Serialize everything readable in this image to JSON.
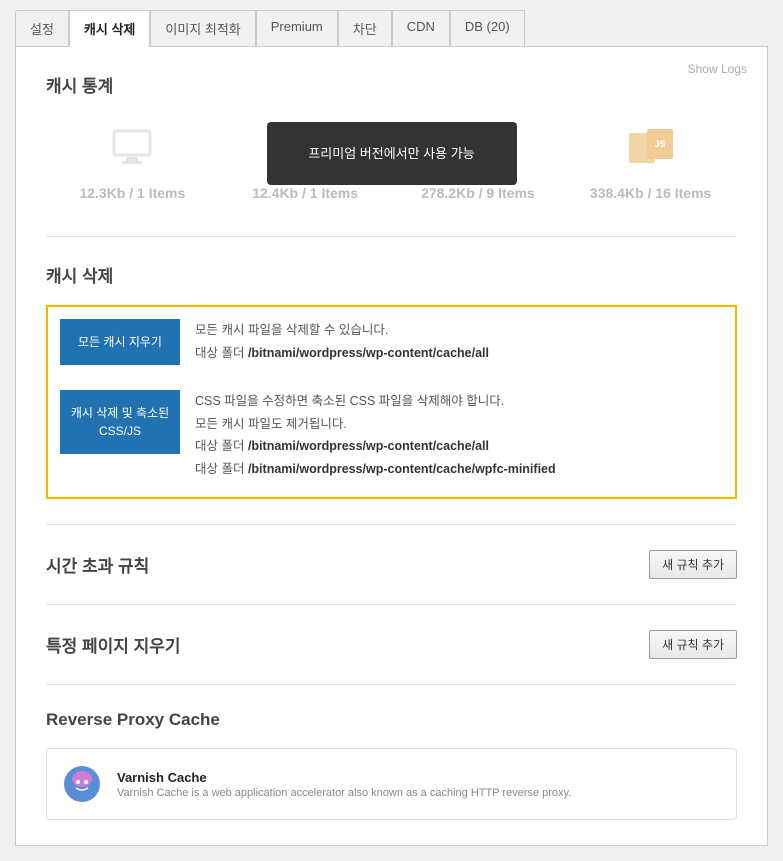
{
  "tabs": [
    {
      "label": "설정"
    },
    {
      "label": "캐시 삭제"
    },
    {
      "label": "이미지 최적화"
    },
    {
      "label": "Premium"
    },
    {
      "label": "차단"
    },
    {
      "label": "CDN"
    },
    {
      "label": "DB (20)"
    }
  ],
  "show_logs": "Show Logs",
  "stats": {
    "title": "캐시 통계",
    "tooltip": "프리미엄 버전에서만 사용 가능",
    "items": [
      {
        "label": "12.3Kb / 1 Items"
      },
      {
        "label": "12.4Kb / 1 Items"
      },
      {
        "label": "278.2Kb / 9 Items"
      },
      {
        "label": "338.4Kb / 16 Items"
      }
    ]
  },
  "delete": {
    "title": "캐시 삭제",
    "actions": [
      {
        "button": "모든 캐시 지우기",
        "lines": [
          {
            "text": "모든 캐시 파일을 삭제할 수 있습니다."
          },
          {
            "prefix": "대상 폴더 ",
            "path": "/bitnami/wordpress/wp-content/cache/all"
          }
        ]
      },
      {
        "button": "캐시 삭제 및 축소된 CSS/JS",
        "lines": [
          {
            "text": "CSS 파일을 수정하면 축소된 CSS 파일을 삭제해야 합니다."
          },
          {
            "text": "모든 캐시 파일도 제거됩니다."
          },
          {
            "prefix": "대상 폴더 ",
            "path": "/bitnami/wordpress/wp-content/cache/all"
          },
          {
            "prefix": "대상 폴더 ",
            "path": "/bitnami/wordpress/wp-content/cache/wpfc-minified"
          }
        ]
      }
    ]
  },
  "timeout": {
    "title": "시간 초과 규칙",
    "button": "새 규칙 추가"
  },
  "clear_page": {
    "title": "특정 페이지 지우기",
    "button": "새 규칙 추가"
  },
  "proxy": {
    "title": "Reverse Proxy Cache",
    "item": {
      "name": "Varnish Cache",
      "desc": "Varnish Cache is a web application accelerator also known as a caching HTTP reverse proxy."
    }
  }
}
